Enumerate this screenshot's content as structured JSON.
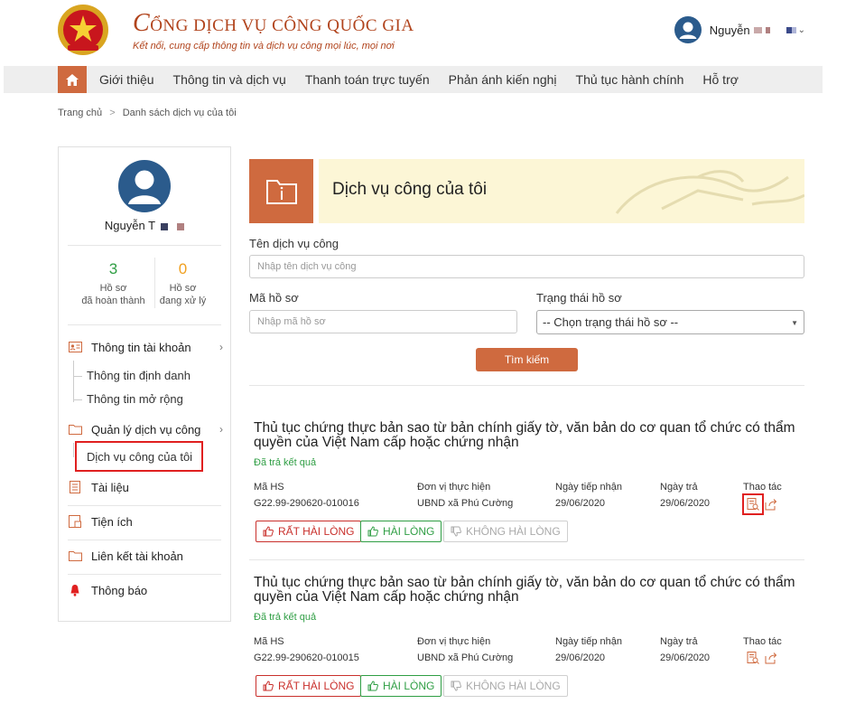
{
  "header": {
    "title": "CỔNG DỊCH VỤ CÔNG QUỐC GIA",
    "title_initial": "C",
    "title_rest": "ỔNG DỊCH VỤ CÔNG QUỐC GIA",
    "subtitle": "Kết nối, cung cấp thông tin và dịch vụ công mọi lúc, mọi nơi",
    "user_name": "Nguyễn"
  },
  "nav": {
    "items": [
      "Giới thiệu",
      "Thông tin và dịch vụ",
      "Thanh toán trực tuyến",
      "Phản ánh kiến nghị",
      "Thủ tục hành chính",
      "Hỗ trợ"
    ]
  },
  "breadcrumb": {
    "home": "Trang chủ",
    "separator": ">",
    "current": "Danh sách dịch vụ của tôi"
  },
  "sidebar": {
    "user_name": "Nguyễn T",
    "stats": [
      {
        "value": "3",
        "label_line1": "Hồ sơ",
        "label_line2": "đã hoàn thành",
        "color": "#2f9e44"
      },
      {
        "value": "0",
        "label_line1": "Hồ sơ",
        "label_line2": "đang xử lý",
        "color": "#f0a020"
      }
    ],
    "account": {
      "label": "Thông tin tài khoản",
      "sub": [
        "Thông tin định danh",
        "Thông tin mở rộng"
      ]
    },
    "services": {
      "label": "Quản lý dịch vụ công",
      "sub": [
        "Dịch vụ công của tôi"
      ]
    },
    "items": [
      "Tài liệu",
      "Tiện ích",
      "Liên kết tài khoản",
      "Thông báo"
    ]
  },
  "main": {
    "banner_title": "Dịch vụ công của tôi",
    "service_name_label": "Tên dịch vụ công",
    "service_name_placeholder": "Nhập tên dịch vụ công",
    "record_code_label": "Mã hồ sơ",
    "record_code_placeholder": "Nhập mã hồ sơ",
    "status_label": "Trạng thái hồ sơ",
    "status_value": "-- Chọn trạng thái hồ sơ --",
    "search_button": "Tìm kiếm"
  },
  "columns": {
    "code": "Mã HS",
    "unit": "Đơn vị thực hiện",
    "received": "Ngày tiếp nhận",
    "returned": "Ngày trả",
    "actions": "Thao tác"
  },
  "ratings": {
    "very_satisfied": "RẤT HÀI LÒNG",
    "satisfied": "HÀI LÒNG",
    "unsatisfied": "KHÔNG HÀI LÒNG"
  },
  "records": [
    {
      "title": "Thủ tục chứng thực bản sao từ bản chính giấy tờ, văn bản do cơ quan tổ chức có thẩm quyền của Việt Nam cấp hoặc chứng nhận",
      "status": "Đã trả kết quả",
      "code": "G22.99-290620-010016",
      "unit": "UBND xã Phú Cường",
      "received": "29/06/2020",
      "returned": "29/06/2020"
    },
    {
      "title": "Thủ tục chứng thực bản sao từ bản chính giấy tờ, văn bản do cơ quan tổ chức có thẩm quyền của Việt Nam cấp hoặc chứng nhận",
      "status": "Đã trả kết quả",
      "code": "G22.99-290620-010015",
      "unit": "UBND xã Phú Cường",
      "received": "29/06/2020",
      "returned": "29/06/2020"
    }
  ],
  "colors": {
    "accent": "#cf6a3f",
    "brand": "#b1441d",
    "success": "#2f9e44",
    "warning": "#f0a020",
    "highlight": "#e02020",
    "banner_bg": "#fcf6d6"
  }
}
